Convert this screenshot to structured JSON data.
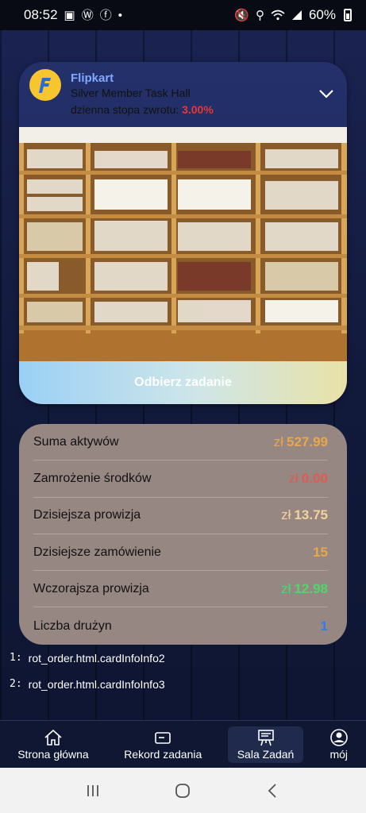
{
  "status_bar": {
    "time": "08:52",
    "battery": "60%",
    "icons_left": [
      "image-icon",
      "wordpress-icon",
      "facebook-icon",
      "dot-icon"
    ],
    "icons_right": [
      "mute-icon",
      "location-icon",
      "wifi-icon",
      "signal-icon",
      "battery-icon"
    ]
  },
  "card": {
    "brand": "Flipkart",
    "tier": "Silver Member Task Hall",
    "rate_label": "dzienna stopa zwrotu: ",
    "rate_value": "3.00%",
    "cta_label": "Odbierz zadanie"
  },
  "stats": {
    "rows": [
      {
        "label": "Suma aktywów",
        "currency": "zł",
        "value": "527.99",
        "color": "#e8a84a"
      },
      {
        "label": "Zamrożenie środków",
        "currency": "zł",
        "value": "0.00",
        "color": "#e05a4f"
      },
      {
        "label": "Dzisiejsza prowizja",
        "currency": "zł",
        "value": "13.75",
        "color": "#f2d39a"
      },
      {
        "label": "Dzisiejsze zamówienie",
        "currency": "",
        "value": "15",
        "color": "#e8a84a"
      },
      {
        "label": "Wczorajsza prowizja",
        "currency": "zł",
        "value": "12.98",
        "color": "#4fd86a"
      },
      {
        "label": "Liczba drużyn",
        "currency": "",
        "value": "1",
        "color": "#2f7bf0"
      }
    ]
  },
  "notes": [
    {
      "num": "1:",
      "text": "rot_order.html.cardInfoInfo2"
    },
    {
      "num": "2:",
      "text": "rot_order.html.cardInfoInfo3"
    }
  ],
  "nav": {
    "home": "Strona główna",
    "record": "Rekord zadania",
    "hall": "Sala Zadań",
    "mine": "mój"
  }
}
